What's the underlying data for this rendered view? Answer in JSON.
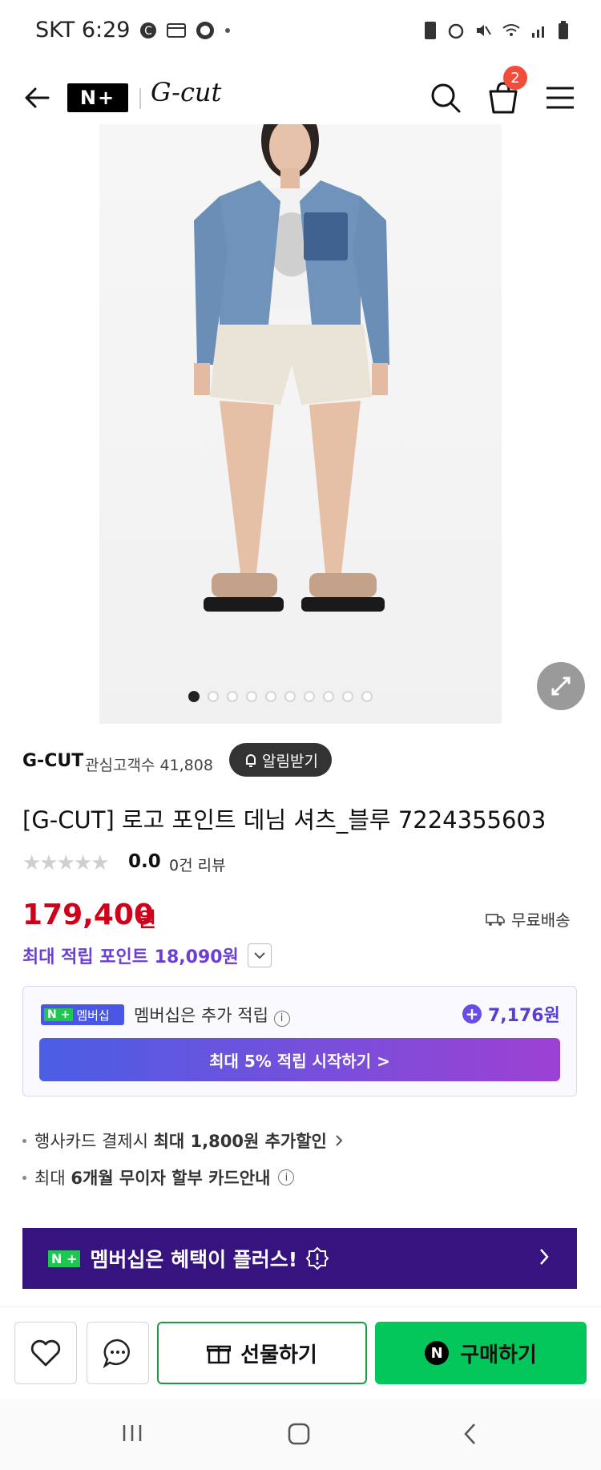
{
  "status_bar": {
    "time": "SKT 6:29"
  },
  "header": {
    "brand_logo": "N+",
    "shop_logo": "G-cut",
    "cart_count": "2"
  },
  "gallery": {
    "total": 10,
    "active_index": 0
  },
  "product": {
    "brand": "G-CUT",
    "followers": "관심고객수 41,808",
    "alarm_label": "알림받기",
    "title": "[G-CUT] 로고 포인트 데님 셔츠_블루 7224355603",
    "rating": "0.0",
    "reviews": "0건 리뷰",
    "price": "179,400",
    "price_unit": "원",
    "shipping": "무료배송",
    "points": "최대 적립 포인트 18,090원"
  },
  "membership": {
    "tag_np": "N +",
    "tag_label": "멤버십",
    "text": "멤버십은 추가 적립",
    "points": "7,176원",
    "cta": "최대 5% 적립 시작하기 >"
  },
  "benefits": [
    {
      "prefix": "행사카드 결제시 ",
      "bold": "최대 1,800원 추가할인"
    },
    {
      "prefix": "최대 ",
      "bold": "6개월 무이자 할부 카드안내"
    }
  ],
  "banner": {
    "np": "N +",
    "text": "멤버십은 혜택이 플러스!"
  },
  "bottom": {
    "gift": "선물하기",
    "buy": "구매하기",
    "buy_icon": "N"
  },
  "colors": {
    "price": "#d0021b",
    "points": "#6b3fd4",
    "buy": "#03c75a",
    "banner": "#36137e"
  }
}
